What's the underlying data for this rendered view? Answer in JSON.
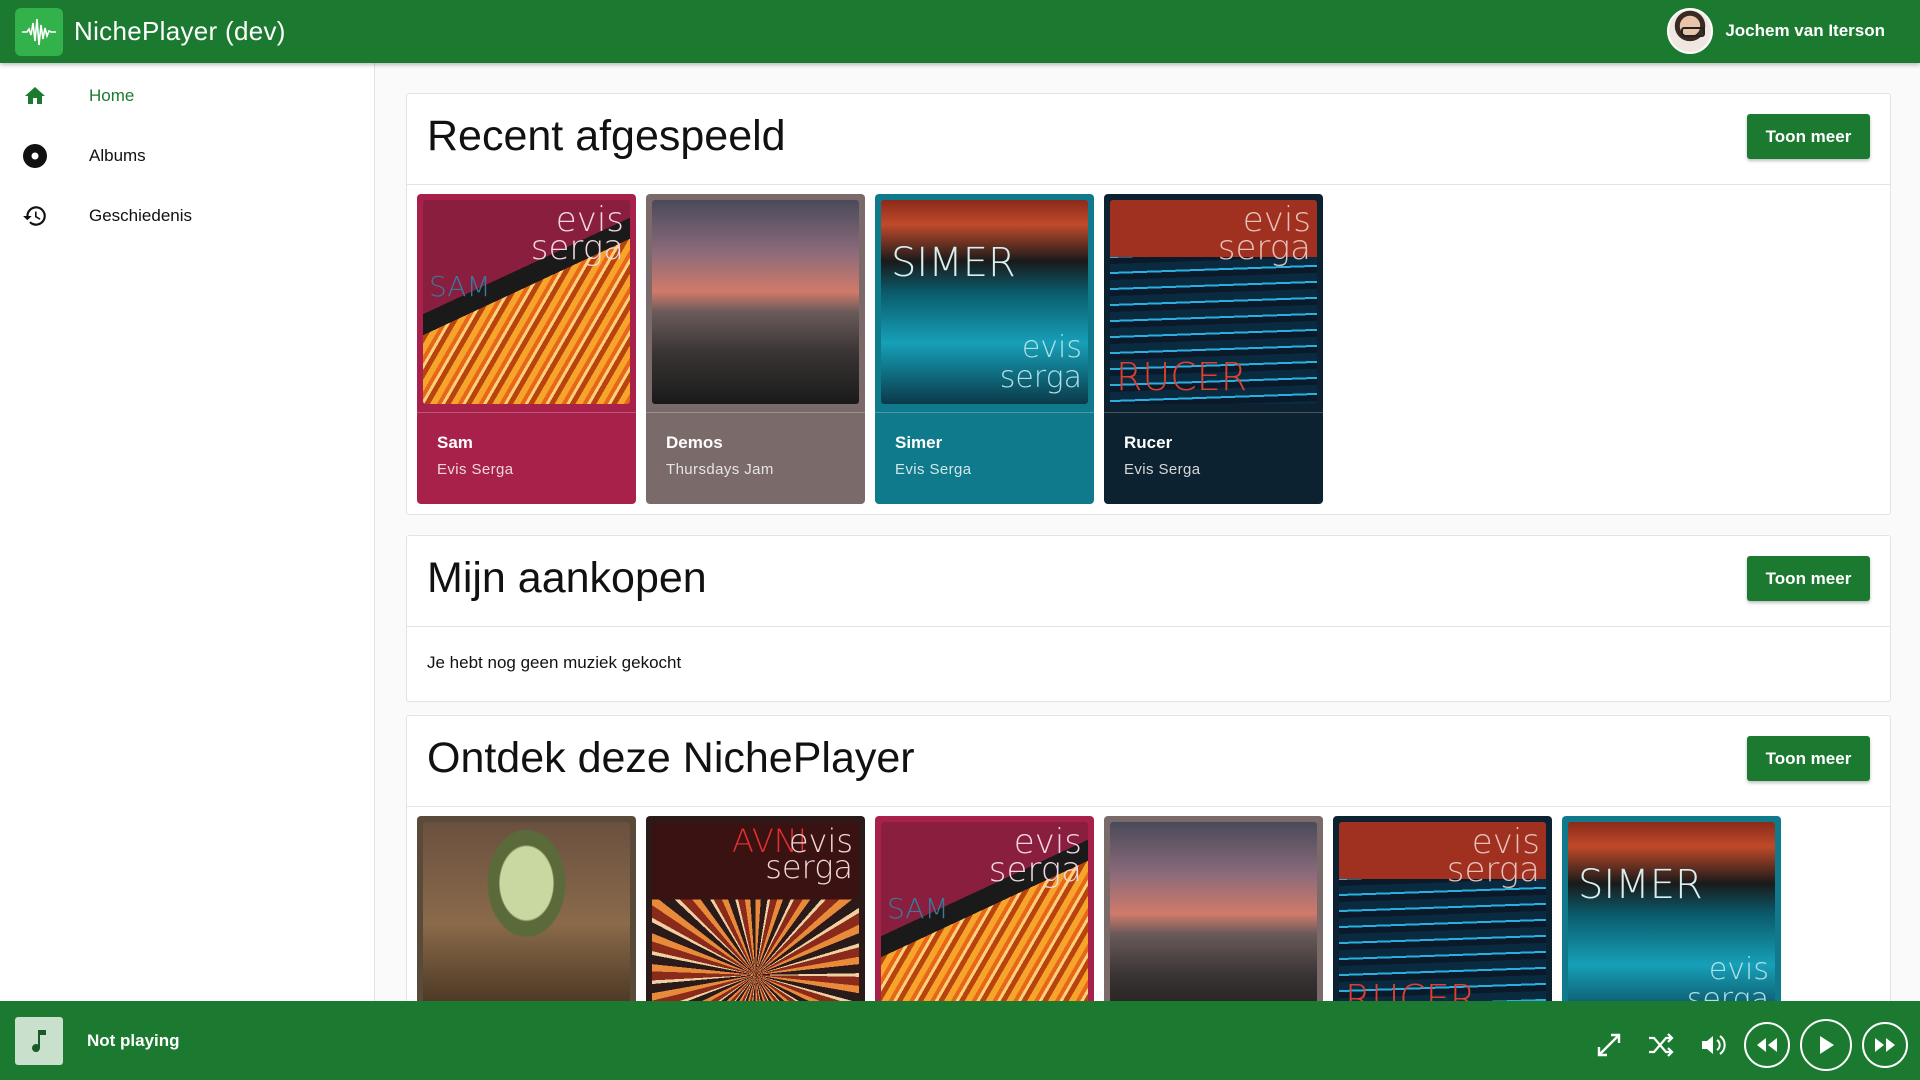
{
  "app": {
    "title": "NichePlayer (dev)",
    "logo_icon": "waveform-icon"
  },
  "user": {
    "name": "Jochem van Iterson"
  },
  "sidebar": {
    "items": [
      {
        "label": "Home",
        "icon": "home-icon",
        "active": true
      },
      {
        "label": "Albums",
        "icon": "disc-icon",
        "active": false
      },
      {
        "label": "Geschiedenis",
        "icon": "history-icon",
        "active": false
      }
    ]
  },
  "sections": {
    "recent": {
      "title": "Recent afgespeeld",
      "more_label": "Toon meer",
      "cards": [
        {
          "title": "Sam",
          "artist": "Evis Serga",
          "color": "#a8214a"
        },
        {
          "title": "Demos",
          "artist": "Thursdays Jam",
          "color": "#7a6a6a"
        },
        {
          "title": "Simer",
          "artist": "Evis Serga",
          "color": "#0e7a8c"
        },
        {
          "title": "Rucer",
          "artist": "Evis Serga",
          "color": "#0d2230"
        }
      ]
    },
    "purchases": {
      "title": "Mijn aankopen",
      "more_label": "Toon meer",
      "empty_text": "Je hebt nog geen muziek gekocht"
    },
    "discover": {
      "title": "Ontdek deze NichePlayer",
      "more_label": "Toon meer"
    }
  },
  "cover_text": {
    "evis": "evis",
    "serga": "serga",
    "sam": "SAM",
    "simer": "SIMER",
    "rucer": "RUCER",
    "avni": "AVNI"
  },
  "player": {
    "status": "Not playing",
    "thumb_icon": "music-note-icon"
  },
  "colors": {
    "primary": "#1b7a30"
  }
}
